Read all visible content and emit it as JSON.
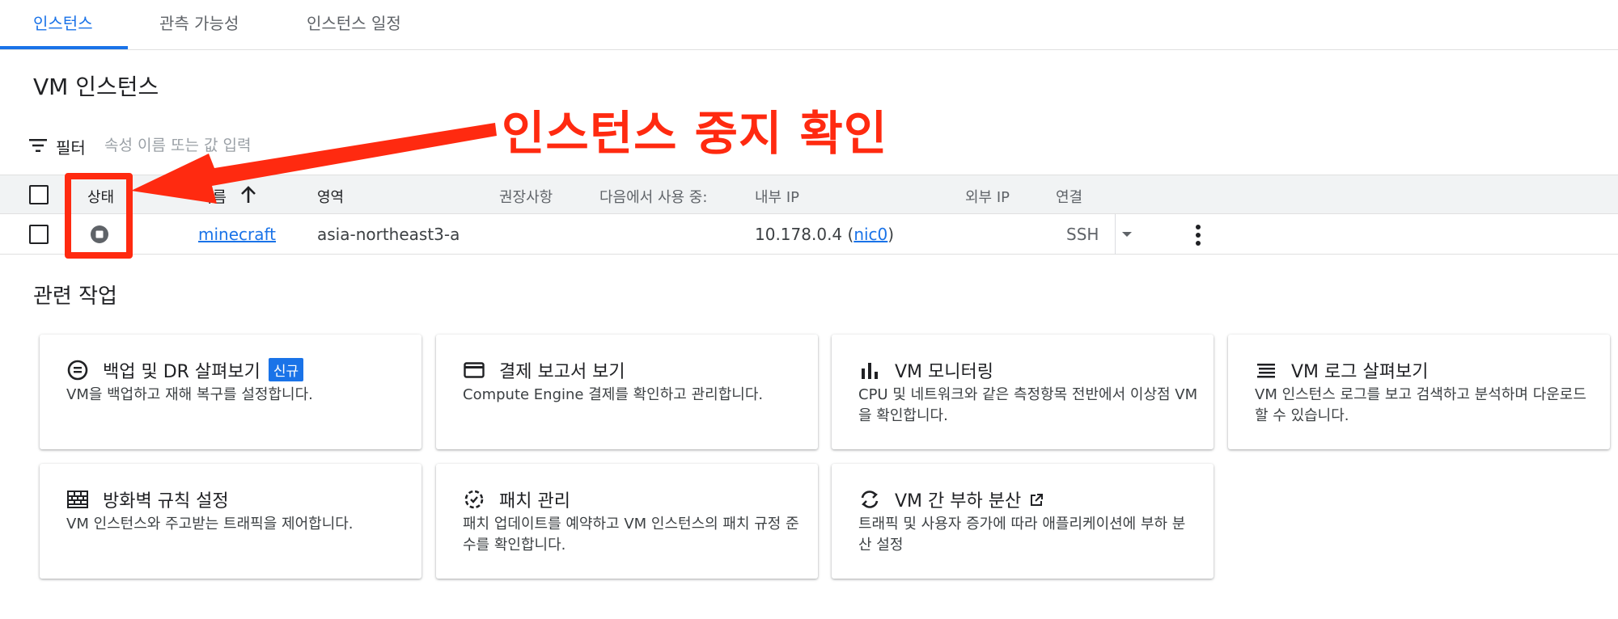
{
  "tabs": [
    {
      "label": "인스턴스",
      "active": true
    },
    {
      "label": "관측 가능성",
      "active": false
    },
    {
      "label": "인스턴스 일정",
      "active": false
    }
  ],
  "page_title": "VM 인스턴스",
  "filter": {
    "label": "필터",
    "placeholder": "속성 이름 또는 값 입력",
    "icon": "filter-icon"
  },
  "table": {
    "columns": {
      "status": "상태",
      "name": "이름",
      "zone": "영역",
      "recommendation": "권장사항",
      "in_use_by": "다음에서 사용 중:",
      "internal_ip": "내부 IP",
      "external_ip": "외부 IP",
      "connect": "연결"
    },
    "rows": [
      {
        "status": "stopped",
        "name": "minecraft",
        "zone": "asia-northeast3-a",
        "internal_ip": "10.178.0.4 (",
        "nic": "nic0",
        "internal_ip_close": ")",
        "connect": "SSH"
      }
    ]
  },
  "related": {
    "title": "관련 작업",
    "cards": [
      {
        "title": "백업 및 DR 살펴보기",
        "badge": "신규",
        "desc": "VM을 백업하고 재해 복구를 설정합니다.",
        "icon": "backup-icon"
      },
      {
        "title": "결제 보고서 보기",
        "desc": "Compute Engine 결제를 확인하고 관리합니다.",
        "icon": "billing-card-icon"
      },
      {
        "title": "VM 모니터링",
        "desc": "CPU 및 네트워크와 같은 측정항목 전반에서 이상점 VM을 확인합니다.",
        "icon": "bar-chart-icon"
      },
      {
        "title": "VM 로그 살펴보기",
        "desc": "VM 인스턴스 로그를 보고 검색하고 분석하며 다운로드할 수 있습니다.",
        "icon": "logs-icon"
      },
      {
        "title": "방화벽 규칙 설정",
        "desc": "VM 인스턴스와 주고받는 트래픽을 제어합니다.",
        "icon": "firewall-icon"
      },
      {
        "title": "패치 관리",
        "desc": "패치 업데이트를 예약하고 VM 인스턴스의 패치 규정 준수를 확인합니다.",
        "icon": "patch-icon"
      },
      {
        "title": "VM 간 부하 분산",
        "desc": "트래픽 및 사용자 증가에 따라 애플리케이션에 부하 분산 설정",
        "icon": "load-balance-icon",
        "external": true
      }
    ]
  },
  "annotation": {
    "text": "인스턴스 중지 확인",
    "color": "#ff2a10"
  },
  "colors": {
    "accent": "#1a73e8",
    "text": "#202124",
    "muted": "#5f6368"
  }
}
